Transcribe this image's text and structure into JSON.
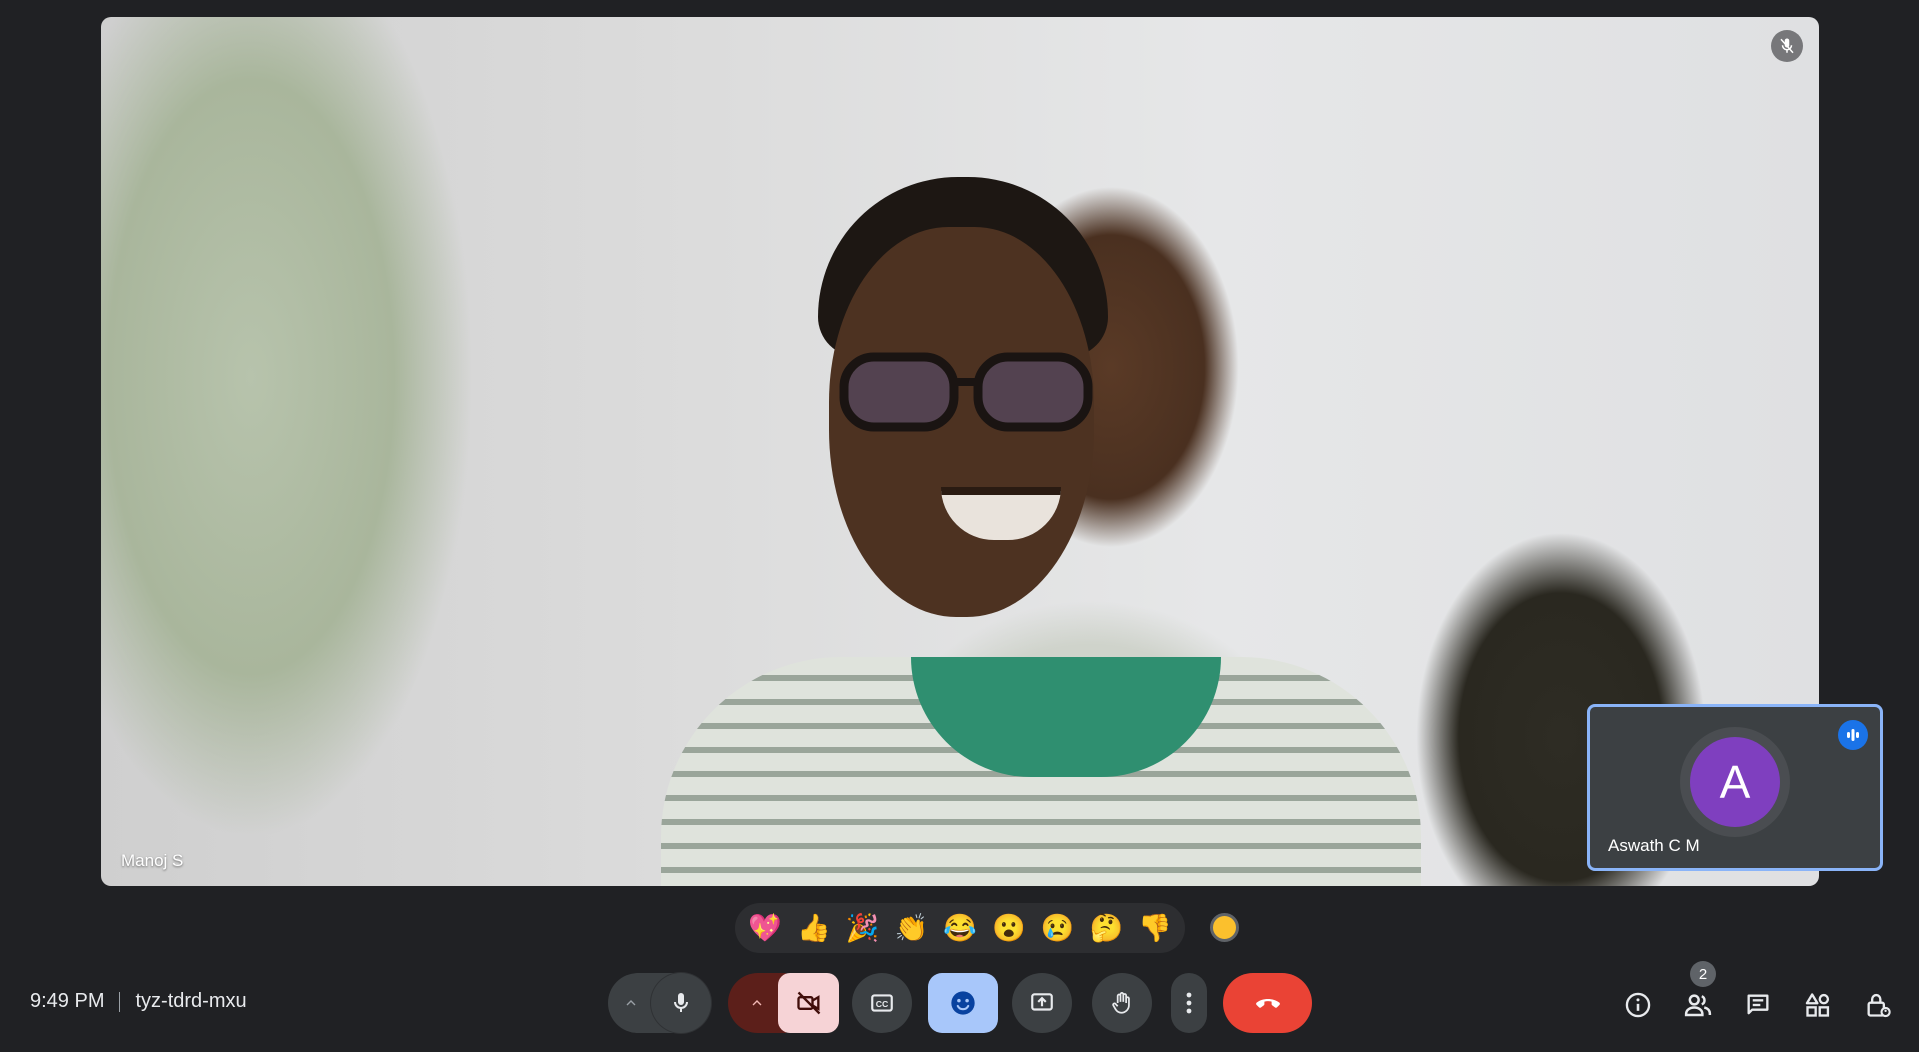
{
  "main_tile": {
    "participant_name": "Manoj S"
  },
  "self_tile": {
    "participant_name": "Aswath C M",
    "avatar_letter": "A"
  },
  "reactions": {
    "items": [
      "💖",
      "👍",
      "🎉",
      "👏",
      "😂",
      "😮",
      "😢",
      "🤔",
      "👎"
    ]
  },
  "meeting": {
    "time": "9:49 PM",
    "code": "tyz-tdrd-mxu"
  },
  "toolbar": {
    "people_count": "2"
  },
  "colors": {
    "background": "#202124",
    "end_call": "#ea4335",
    "camera_off_bg": "#f6d3d6",
    "camera_off_arrow_bg": "#5c1f1a",
    "reactions_active_bg": "#a8c7fa",
    "self_tile_border": "#8ab4f8",
    "avatar": "#7f3fbf"
  }
}
